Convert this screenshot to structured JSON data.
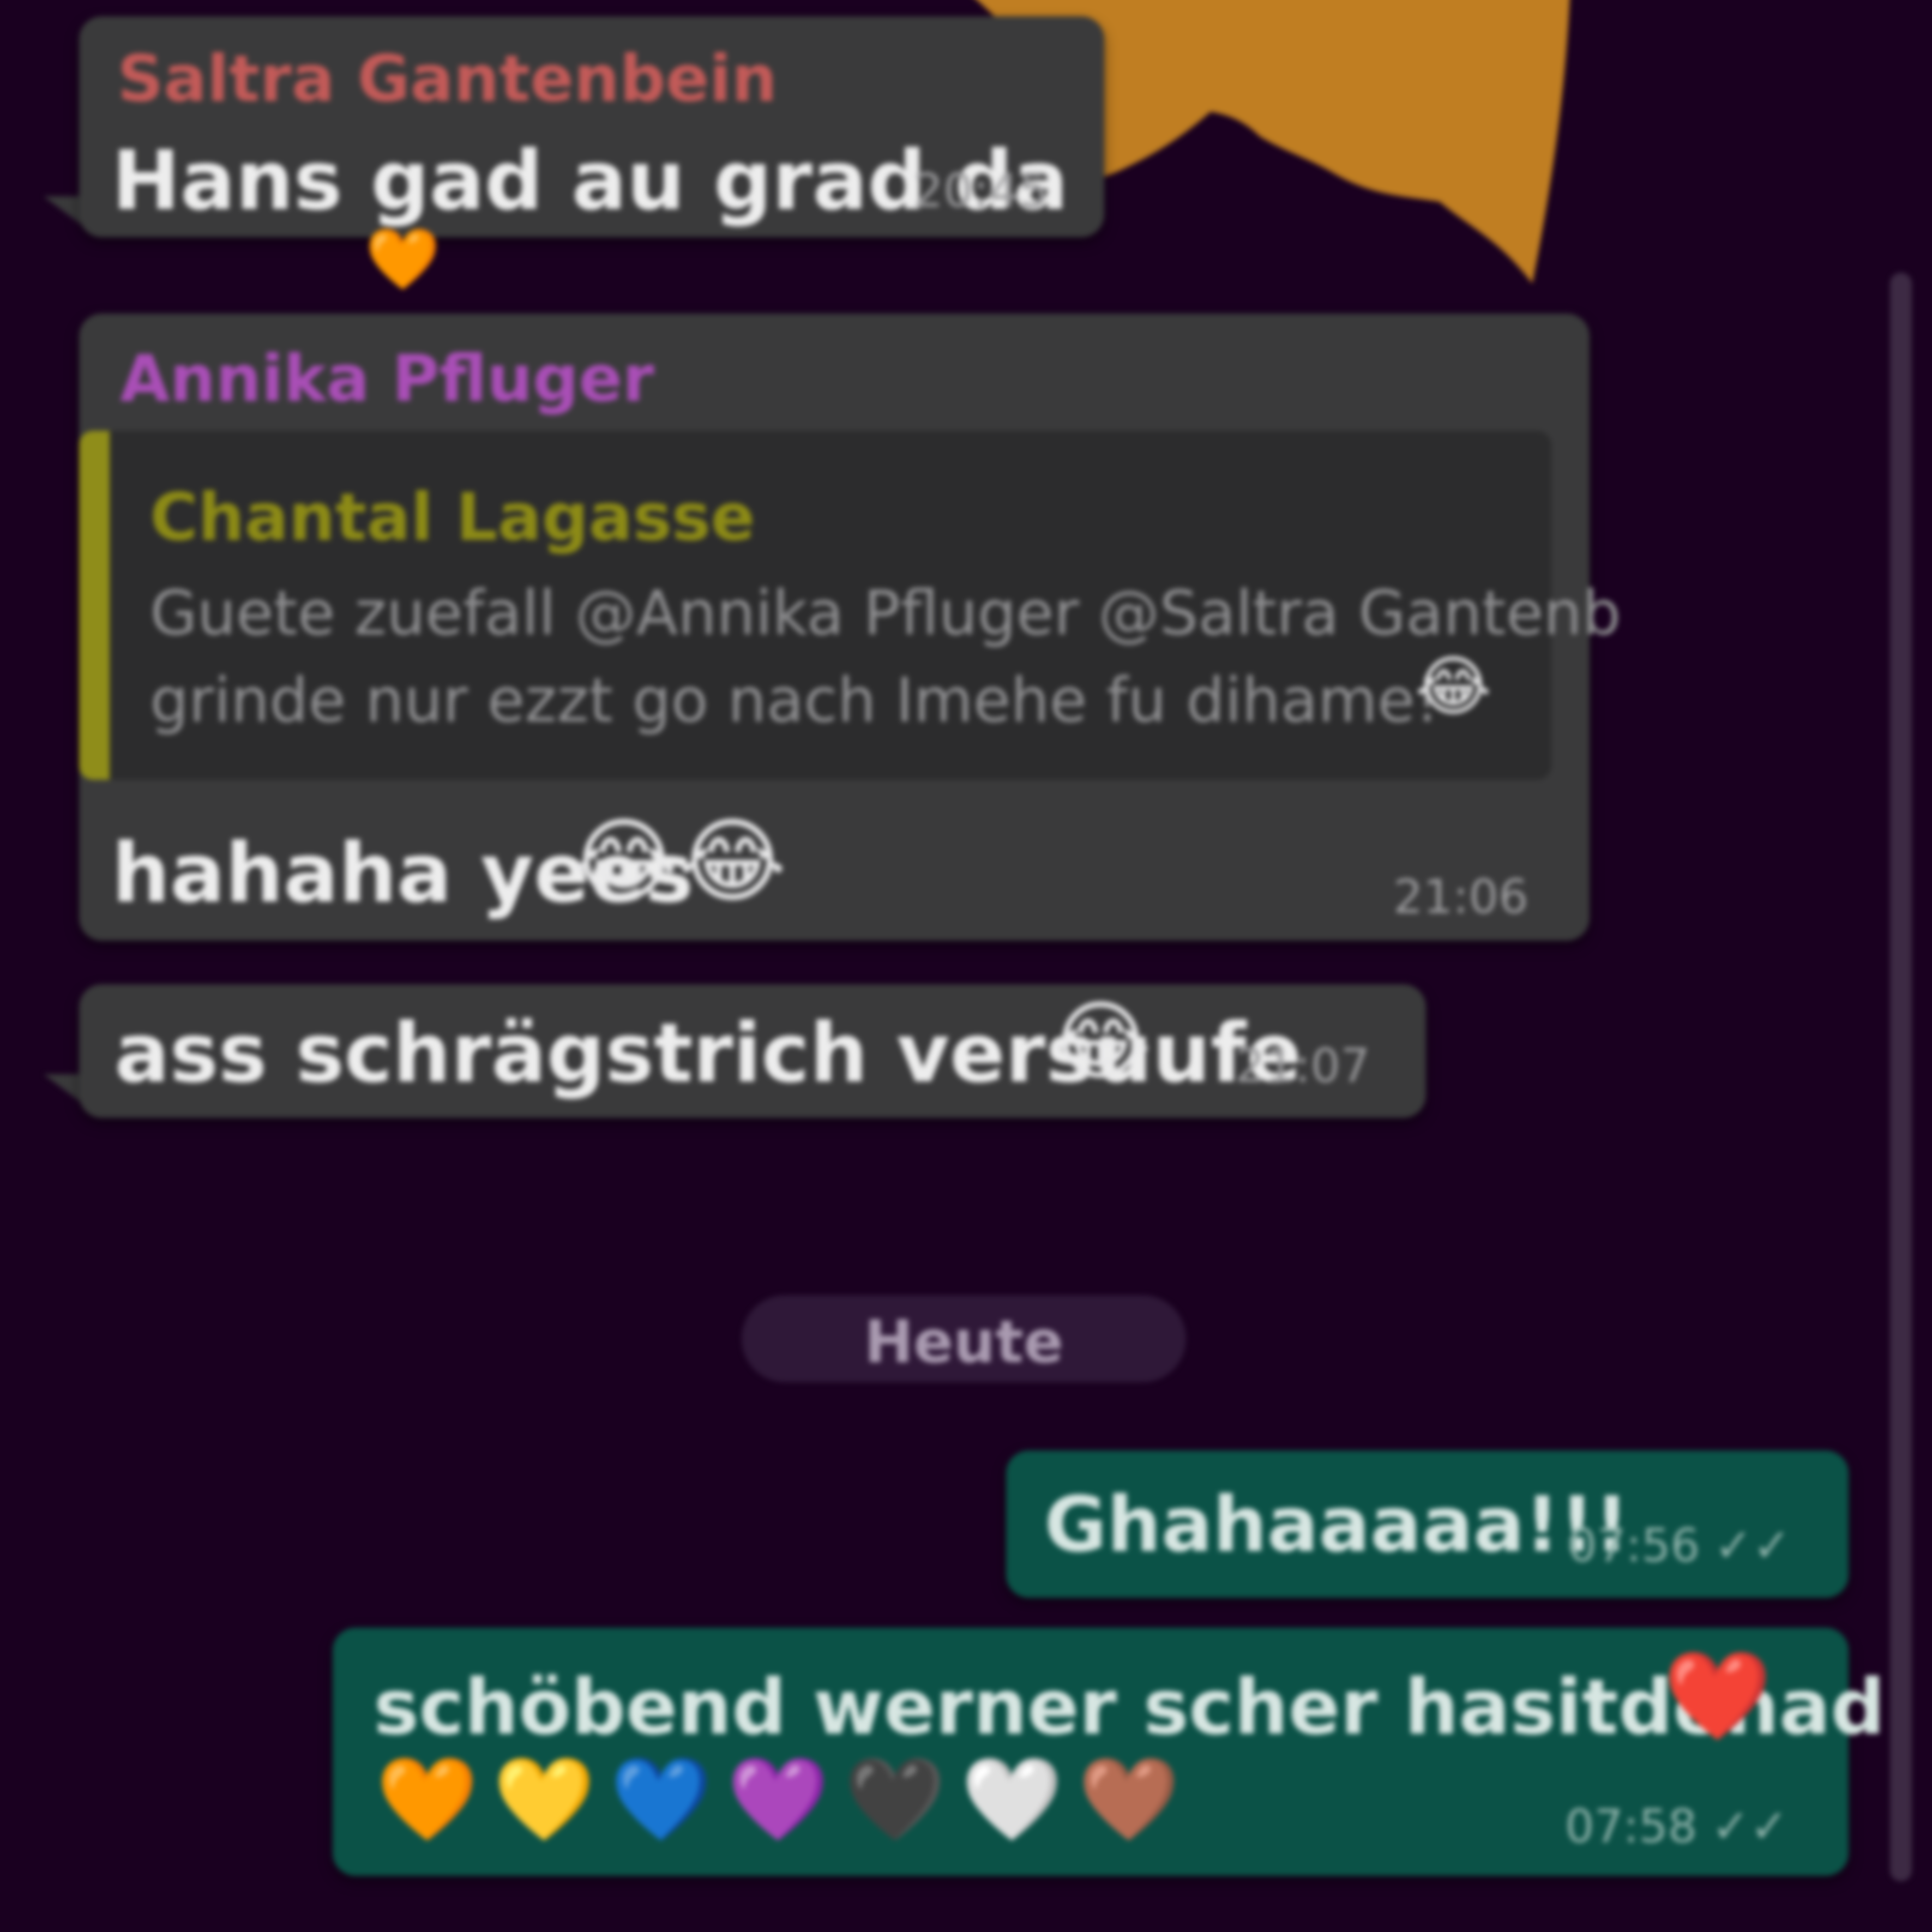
{
  "chat": {
    "messages": [
      {
        "sender": "Saltra Gantenbein",
        "sender_color": "#c25a58",
        "text": "Hans gad au grad da",
        "time": "20:45",
        "reaction": "🧡"
      },
      {
        "sender": "Annika Pfluger",
        "sender_color": "#a94eb6",
        "quote": {
          "sender": "Chantal Lagasse",
          "sender_color": "#8c8a16",
          "line1": "Guete zuefall @Annika Pfluger @Saltra Gantenb",
          "line2": "grinde nur ezzt go nach Imehe fu dihame!",
          "emoji": "😂"
        },
        "text": "hahaha yees",
        "emoji": "😂😂",
        "time": "21:06"
      },
      {
        "text": "ass schrägstrich versuufe",
        "emoji": "😂",
        "time": "21:07"
      }
    ],
    "date_divider": "Heute",
    "outgoing": [
      {
        "text": "Ghahaaaaa!!!",
        "time": "07:56 ✓✓"
      },
      {
        "text": "schöbend werner scher hasitdenad",
        "emoji": "❤️",
        "hearts": "🧡 💛 💙 💜 🖤 🤍 🤎",
        "time": "07:58 ✓✓"
      }
    ]
  },
  "colors": {
    "background": "#1a0020",
    "incoming_bubble": "#3a3a3b",
    "outgoing_bubble": "#0b5247",
    "accent_orange": "#c07e22"
  },
  "icons": [
    "orange-heart-icon",
    "scrollbar"
  ]
}
